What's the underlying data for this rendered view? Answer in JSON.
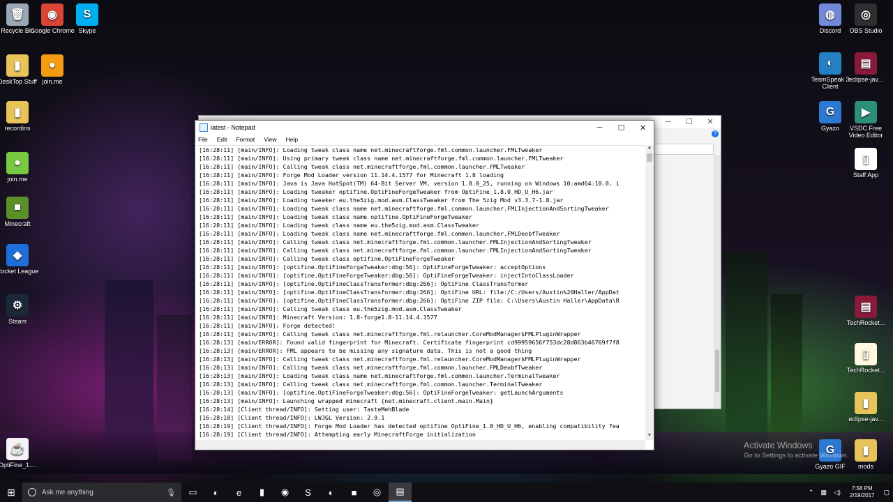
{
  "desktop_left": [
    {
      "label": "Recycle Bin",
      "icon": "recycle-bin-icon",
      "glyph": "🗑",
      "color": "#9aa7b5"
    },
    {
      "label": "Google Chrome",
      "icon": "chrome-icon",
      "glyph": "◉",
      "color": "#db4437"
    },
    {
      "label": "Skype",
      "icon": "skype-icon",
      "glyph": "S",
      "color": "#00aff0"
    },
    {
      "label": "DeskTop Stuff",
      "icon": "folder-icon",
      "glyph": "▮",
      "color": "#e8c35a"
    },
    {
      "label": "join.me",
      "icon": "joinme-icon",
      "glyph": "●",
      "color": "#f39c12"
    },
    {
      "label": "recordins",
      "icon": "folder-icon",
      "glyph": "▮",
      "color": "#e8c35a"
    },
    {
      "label": "join.me",
      "icon": "joinme-icon",
      "glyph": "●",
      "color": "#7ac943"
    },
    {
      "label": "Minecraft",
      "icon": "minecraft-icon",
      "glyph": "■",
      "color": "#5a8f29"
    },
    {
      "label": "Rocket League",
      "icon": "rocket-league-icon",
      "glyph": "◆",
      "color": "#1e6fd9"
    },
    {
      "label": "Steam",
      "icon": "steam-icon",
      "glyph": "⚙",
      "color": "#1b2838"
    },
    {
      "label": "OptiFine_1....",
      "icon": "java-icon",
      "glyph": "☕",
      "color": "#f4f4f4"
    }
  ],
  "desktop_right": [
    {
      "label": "Discord",
      "icon": "discord-icon",
      "glyph": "◍",
      "color": "#7289da"
    },
    {
      "label": "OBS Studio",
      "icon": "obs-icon",
      "glyph": "◎",
      "color": "#302e31"
    },
    {
      "label": "TeamSpeak 3 Client",
      "icon": "teamspeak-icon",
      "glyph": "◐",
      "color": "#2580c3"
    },
    {
      "label": "eclipse-jav...",
      "icon": "archive-icon",
      "glyph": "▤",
      "color": "#8b1a3a"
    },
    {
      "label": "Gyazo",
      "icon": "gyazo-icon",
      "glyph": "G",
      "color": "#2d79d1"
    },
    {
      "label": "VSDC Free Video Editor",
      "icon": "vsdc-icon",
      "glyph": "▶",
      "color": "#2b8f7a"
    },
    {
      "label": "Staff App",
      "icon": "file-icon",
      "glyph": "▯",
      "color": "#ffffff"
    },
    {
      "label": "TechRocket...",
      "icon": "archive-icon",
      "glyph": "▤",
      "color": "#8b1a3a"
    },
    {
      "label": "TechRocket...",
      "icon": "file-icon",
      "glyph": "▯",
      "color": "#fff7e0"
    },
    {
      "label": "eclipse-jav...",
      "icon": "folder-icon",
      "glyph": "▮",
      "color": "#e8c35a"
    },
    {
      "label": "Gyazo GIF",
      "icon": "gyazo-icon",
      "glyph": "G",
      "color": "#2d79d1"
    },
    {
      "label": "mods",
      "icon": "folder-icon",
      "glyph": "▮",
      "color": "#e8c35a"
    }
  ],
  "notepad": {
    "title": "latest - Notepad",
    "menu": [
      "File",
      "Edit",
      "Format",
      "View",
      "Help"
    ],
    "lines": [
      "[16:28:11] [main/INFO]: Loading tweak class name net.minecraftforge.fml.common.launcher.FMLTweaker",
      "[16:28:11] [main/INFO]: Using primary tweak class name net.minecraftforge.fml.common.launcher.FMLTweaker",
      "[16:28:11] [main/INFO]: Calling tweak class net.minecraftforge.fml.common.launcher.FMLTweaker",
      "[16:28:11] [main/INFO]: Forge Mod Loader version 11.14.4.1577 for Minecraft 1.8 loading",
      "[16:28:11] [main/INFO]: Java is Java HotSpot(TM) 64-Bit Server VM, version 1.8.0_25, running on Windows 10:amd64:10.0, i",
      "[16:28:11] [main/INFO]: Loading tweaker optifine.OptiFineForgeTweaker from OptiFine_1.8.0_HD_U_H6.jar",
      "[16:28:11] [main/INFO]: Loading tweaker eu.the5zig.mod.asm.ClassTweaker from The 5zig Mod v3.3.7-1.8.jar",
      "[16:28:11] [main/INFO]: Loading tweak class name net.minecraftforge.fml.common.launcher.FMLInjectionAndSortingTweaker",
      "[16:28:11] [main/INFO]: Loading tweak class name optifine.OptiFineForgeTweaker",
      "[16:28:11] [main/INFO]: Loading tweak class name eu.the5zig.mod.asm.ClassTweaker",
      "[16:28:11] [main/INFO]: Loading tweak class name net.minecraftforge.fml.common.launcher.FMLDeobfTweaker",
      "[16:28:11] [main/INFO]: Calling tweak class net.minecraftforge.fml.common.launcher.FMLInjectionAndSortingTweaker",
      "[16:28:11] [main/INFO]: Calling tweak class net.minecraftforge.fml.common.launcher.FMLInjectionAndSortingTweaker",
      "[16:28:11] [main/INFO]: Calling tweak class optifine.OptiFineForgeTweaker",
      "[16:28:11] [main/INFO]: [optifine.OptiFineForgeTweaker:dbg:56]: OptiFineForgeTweaker: acceptOptions",
      "[16:28:11] [main/INFO]: [optifine.OptiFineForgeTweaker:dbg:56]: OptiFineForgeTweaker: injectIntoClassLoader",
      "[16:28:11] [main/INFO]: [optifine.OptiFineClassTransformer:dbg:266]: OptiFine ClassTransformer",
      "[16:28:11] [main/INFO]: [optifine.OptiFineClassTransformer:dbg:266]: OptiFine URL: file:/C:/Users/Austin%20Haller/AppDat",
      "[16:28:11] [main/INFO]: [optifine.OptiFineClassTransformer:dbg:266]: OptiFine ZIP file: C:\\Users\\Austin Haller\\AppData\\R",
      "[16:28:11] [main/INFO]: Calling tweak class eu.the5zig.mod.asm.ClassTweaker",
      "[16:28:11] [main/INFO]: Minecraft Version: 1.8-forge1.8-11.14.4.1577",
      "[16:28:11] [main/INFO]: Forge detected!",
      "[16:28:11] [main/INFO]: Calling tweak class net.minecraftforge.fml.relauncher.CoreModManager$FMLPluginWrapper",
      "[16:28:13] [main/ERROR]: Found valid fingerprint for Minecraft. Certificate fingerprint cd99959656f753dc28d863b46769f7f8",
      "[16:28:13] [main/ERROR]: FML appears to be missing any signature data. This is not a good thing",
      "[16:28:13] [main/INFO]: Calling tweak class net.minecraftforge.fml.relauncher.CoreModManager$FMLPluginWrapper",
      "[16:28:13] [main/INFO]: Calling tweak class net.minecraftforge.fml.common.launcher.FMLDeobfTweaker",
      "[16:28:13] [main/INFO]: Loading tweak class name net.minecraftforge.fml.common.launcher.TerminalTweaker",
      "[16:28:13] [main/INFO]: Calling tweak class net.minecraftforge.fml.common.launcher.TerminalTweaker",
      "[16:28:13] [main/INFO]: [optifine.OptiFineForgeTweaker:dbg:56]: OptiFineForgeTweaker: getLaunchArguments",
      "[16:28:13] [main/INFO]: Launching wrapped minecraft {net.minecraft.client.main.Main}",
      "[16:28:14] [Client thread/INFO]: Setting user: TasteMehBlade",
      "[16:28:18] [Client thread/INFO]: LWJGL Version: 2.9.1",
      "[16:28:19] [Client thread/INFO]: Forge Mod Loader has detected optifine OptiFine_1.8_HD_U_H6, enabling compatibility fea",
      "[16:28:19] [Client thread/INFO]: Attempting early MinecraftForge initialization"
    ]
  },
  "watermark": {
    "line1": "Activate Windows",
    "line2": "Go to Settings to activate Windows."
  },
  "taskbar": {
    "search_placeholder": "Ask me anything",
    "apps": [
      {
        "name": "task-view-icon",
        "glyph": "▭"
      },
      {
        "name": "browser-icon",
        "glyph": "◐"
      },
      {
        "name": "edge-icon",
        "glyph": "e"
      },
      {
        "name": "file-explorer-icon",
        "glyph": "▮"
      },
      {
        "name": "chrome-icon",
        "glyph": "◉"
      },
      {
        "name": "skype-icon",
        "glyph": "S"
      },
      {
        "name": "teamspeak-icon",
        "glyph": "◐"
      },
      {
        "name": "minecraft-icon",
        "glyph": "■"
      },
      {
        "name": "obs-icon",
        "glyph": "◎"
      },
      {
        "name": "notepad-icon",
        "glyph": "▤"
      }
    ],
    "time": "7:58 PM",
    "date": "2/19/2017"
  }
}
